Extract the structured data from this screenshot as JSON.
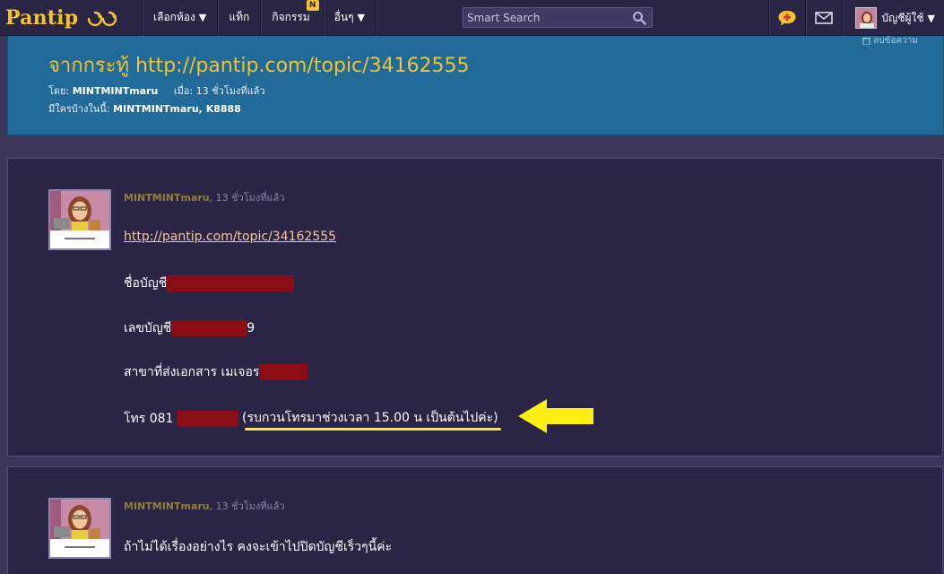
{
  "nav": {
    "logo_text": "Pantip",
    "items": [
      {
        "label": "เลือกห้อง",
        "caret": "▼"
      },
      {
        "label": "แท็ก"
      },
      {
        "label": "กิจกรรม",
        "badge": "N"
      },
      {
        "label": "อื่นๆ",
        "caret": "▼"
      }
    ],
    "search_placeholder": "Smart Search",
    "account_label": "บัญชีผู้ใช้",
    "account_caret": "▼",
    "icons": [
      "new-topic-icon",
      "mail-icon",
      "search-icon"
    ]
  },
  "topic": {
    "title": "จากกระทู้ http://pantip.com/topic/34162555",
    "delete_label": "ลบข้อความ",
    "by_label": "โดย:",
    "by_user": "MINTMINTmaru",
    "when_label": "เมื่อ: 13 ชั่วโมงที่แล้ว",
    "who_label": "มีใครบ้างในนี้:",
    "who_users": "MINTMINTmaru, K8888"
  },
  "comments": [
    {
      "user": "MINTMINTmaru",
      "time": ", 13 ชั่วโมงที่แล้ว",
      "link": "http://pantip.com/topic/34162555",
      "lines": {
        "account_name": "ชื่อบัญชี",
        "account_no": "เลขบัญชี",
        "account_no_tail": "9",
        "branch": "สาขาที่ส่งเอกสาร เมเจอร",
        "phone": "โทร 081",
        "phone_note": "(รบกวนโทรมาช่วงเวลา 15.00 น เป็นต้นไปค่ะ)"
      }
    },
    {
      "user": "MINTMINTmaru",
      "time": ", 13 ชั่วโมงที่แล้ว",
      "text": "ถ้าไม่ได้เรื่องอย่างไร คงจะเข้าไปปิดบัญชีเร็วๆนี้ค่ะ"
    }
  ],
  "colors": {
    "accent": "#f2c230",
    "topic_bg": "#226a98",
    "redaction": "#8a0c14",
    "highlight": "#ffe92a"
  }
}
